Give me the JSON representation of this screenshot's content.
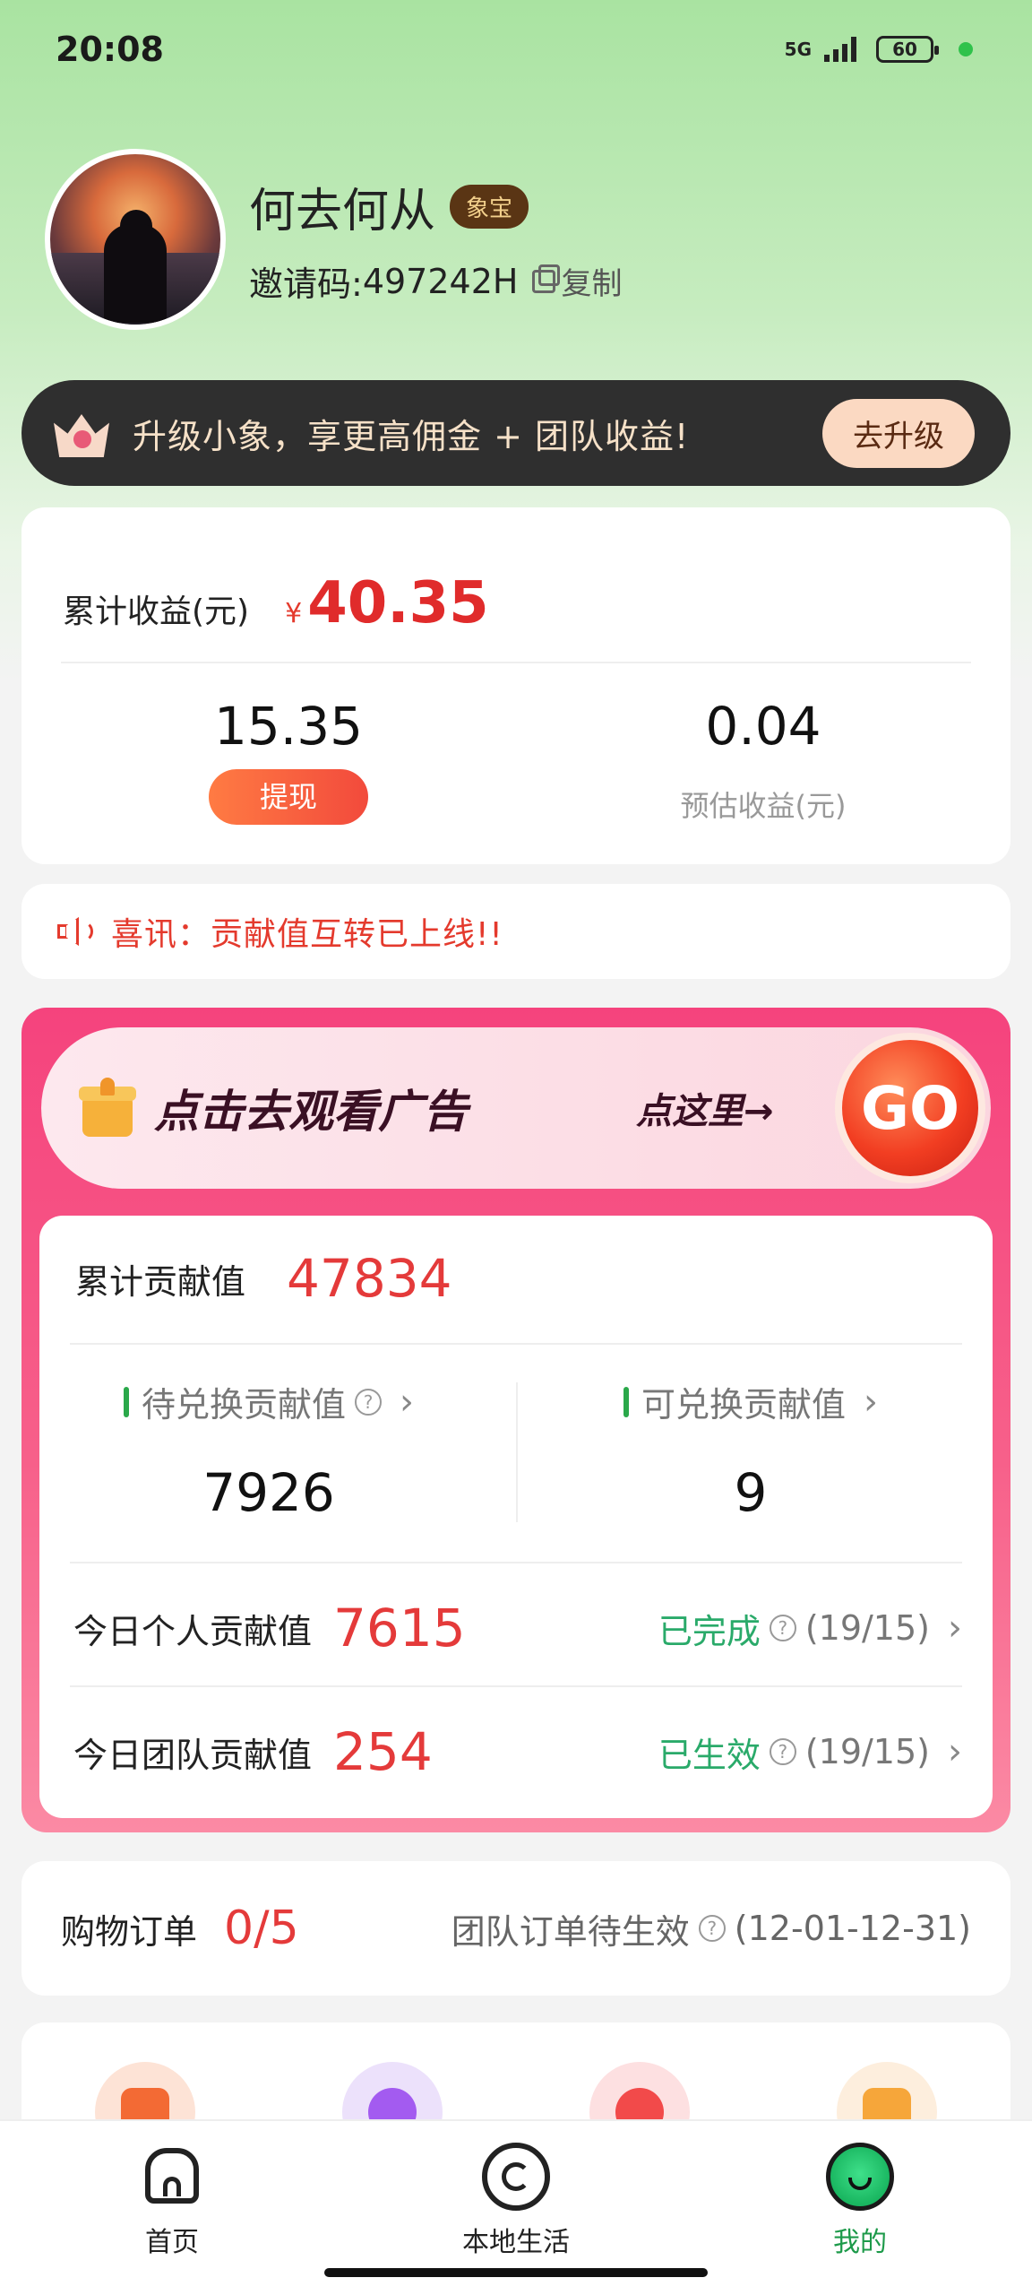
{
  "status_bar": {
    "time": "20:08",
    "network": "5G",
    "battery": "60",
    "dot_color": "#2fc24b"
  },
  "profile": {
    "name": "何去何从",
    "badge": "象宝",
    "invite_label": "邀请码:",
    "invite_code": "497242H",
    "copy_label": "复制",
    "copy_icon": "copy-icon"
  },
  "upgrade": {
    "text": "升级小象，享更高佣金 + 团队收益!",
    "button": "去升级"
  },
  "earnings": {
    "label": "累计收益(元)",
    "currency": "¥",
    "total": "40.35",
    "withdrawable": "15.35",
    "withdraw_button": "提现",
    "estimated": "0.04",
    "estimated_label": "预估收益(元)"
  },
  "notice": {
    "text": "喜讯：贡献值互转已上线!!",
    "icon": "speaker-icon"
  },
  "ad": {
    "title": "点击去观看广告",
    "here": "点这里→",
    "go": "GO"
  },
  "contribution": {
    "total_label": "累计贡献值",
    "total": "47834",
    "pending_label": "待兑换贡献值",
    "pending": "7926",
    "redeemable_label": "可兑换贡献值",
    "redeemable": "9",
    "rows": [
      {
        "label": "今日个人贡献值",
        "value": "7615",
        "status": "已完成",
        "count": "(19/15)"
      },
      {
        "label": "今日团队贡献值",
        "value": "254",
        "status": "已生效",
        "count": "(19/15)"
      }
    ]
  },
  "orders": {
    "label": "购物订单",
    "value": "0/5",
    "team_label": "团队订单待生效",
    "range": "(12-01-12-31)"
  },
  "nav": {
    "items": [
      {
        "label": "首页",
        "icon": "home-icon"
      },
      {
        "label": "本地生活",
        "icon": "local-life-icon"
      },
      {
        "label": "我的",
        "icon": "profile-icon",
        "active": true
      }
    ],
    "active_color": "#1d9a4a"
  },
  "colors": {
    "accent_red": "#e43a2d",
    "pink_panel": "#f5437d",
    "green_status": "#2aaa6a"
  }
}
